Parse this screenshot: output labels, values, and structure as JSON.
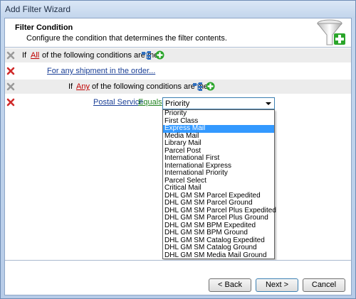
{
  "window": {
    "title": "Add Filter Wizard"
  },
  "header": {
    "title": "Filter Condition",
    "subtitle": "Configure the condition that determines the filter contents."
  },
  "conditions": {
    "row1": {
      "prefix": "If",
      "link": "All",
      "suffix": "of the following conditions are met"
    },
    "row2": {
      "link": "For any shipment in the order..."
    },
    "row3": {
      "prefix": "If",
      "link": "Any",
      "suffix": "of the following conditions are met"
    },
    "row4": {
      "field": "Postal Service",
      "operator": "Equals",
      "value": "Priority"
    }
  },
  "dropdown": {
    "options": [
      "Priority",
      "First Class",
      "Express Mail",
      "Media Mail",
      "Library Mail",
      "Parcel Post",
      "International First",
      "International Express",
      "International Priority",
      "Parcel Select",
      "Critical Mail",
      "DHL GM SM Parcel Expedited",
      "DHL GM SM Parcel Ground",
      "DHL GM SM Parcel Plus Expedited",
      "DHL GM SM Parcel Plus Ground",
      "DHL GM SM BPM Expedited",
      "DHL GM SM BPM Ground",
      "DHL GM SM Catalog Expedited",
      "DHL GM SM Catalog Ground",
      "DHL GM SM Media Mail Ground"
    ],
    "highlighted": "Express Mail"
  },
  "footer": {
    "back_label": "< Back",
    "next_label": "Next >",
    "cancel_label": "Cancel"
  },
  "icons": {
    "delete": "delete-x-icon",
    "add_group": "tree-group-icon",
    "add": "add-plus-icon",
    "wizard": "funnel-add-icon"
  },
  "colors": {
    "accent_red": "#c00000",
    "link_blue": "#1a3f96",
    "link_green": "#218321",
    "selection": "#3399ff"
  }
}
